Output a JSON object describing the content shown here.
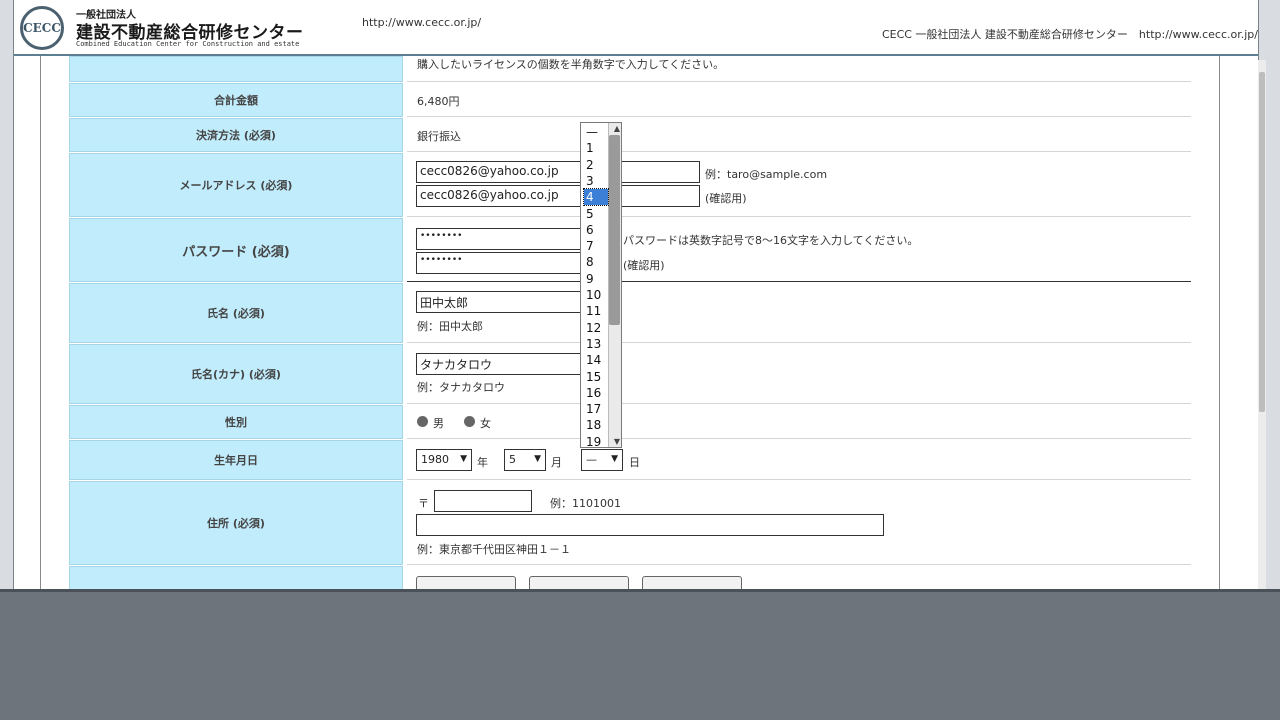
{
  "header": {
    "logo_mark": "CECC",
    "logo_small": "一般社団法人",
    "logo_title": "建設不動産総合研修センター",
    "logo_sub": "Combined Education Center for Construction and estate",
    "url": "http://www.cecc.or.jp/",
    "right_text": "CECC 一般社団法人 建設不動産総合研修センター　http://www.cecc.or.jp/"
  },
  "form": {
    "license_note": "購入したいライセンスの個数を半角数字で入力してください。",
    "total": {
      "label": "合計金額",
      "value": "6,480円"
    },
    "payment": {
      "label": "決済方法 (必須)",
      "value": "銀行振込"
    },
    "email": {
      "label": "メールアドレス (必須)",
      "value": "cecc0826@yahoo.co.jp",
      "confirm_value": "cecc0826@yahoo.co.jp",
      "example": "例：taro@sample.com",
      "confirm_note": "(確認用)"
    },
    "password": {
      "label": "パスワード (必須)",
      "value": "••••••••",
      "confirm_value": "••••••••",
      "note": "パスワードは英数字記号で8～16文字を入力してください。",
      "confirm_note": "(確認用)"
    },
    "name": {
      "label": "氏名 (必須)",
      "value": "田中太郎",
      "example": "例：田中太郎"
    },
    "kana": {
      "label": "氏名(カナ) (必須)",
      "value": "タナカタロウ",
      "example": "例：タナカタロウ"
    },
    "gender": {
      "label": "性別",
      "male": "男",
      "female": "女"
    },
    "birthday": {
      "label": "生年月日",
      "year": "1980",
      "year_unit": "年",
      "month": "5",
      "month_unit": "月",
      "day": "—",
      "day_unit": "日"
    },
    "address": {
      "label": "住所 (必須)",
      "postal_mark": "〒",
      "postal_example": "例：1101001",
      "example": "例：東京都千代田区神田１－１"
    }
  },
  "day_dropdown": {
    "options": [
      "—",
      "1",
      "2",
      "3",
      "4",
      "5",
      "6",
      "7",
      "8",
      "9",
      "10",
      "11",
      "12",
      "13",
      "14",
      "15",
      "16",
      "17",
      "18",
      "19"
    ],
    "selected": "4"
  }
}
